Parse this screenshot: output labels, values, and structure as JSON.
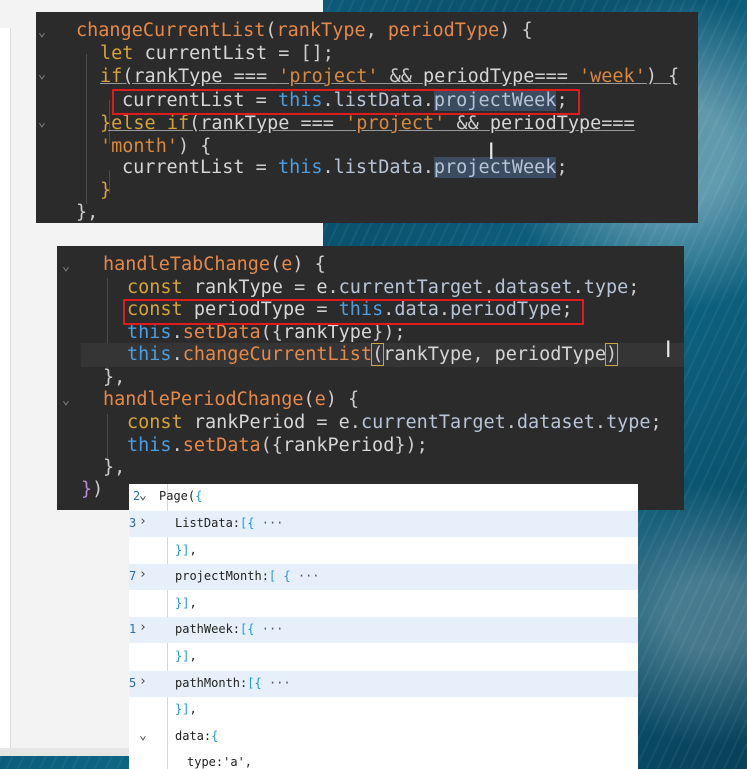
{
  "window1": {
    "lines": [
      {
        "t": "changeCurrentList(rankType, periodType) {"
      },
      {
        "t": "let currentList = [];"
      },
      {
        "t": "if(rankType === 'project' && periodType=== 'week') {"
      },
      {
        "t": "currentList = this.listData.projectWeek;"
      },
      {
        "t": "}else if(rankType === 'project' && periodType==="
      },
      {
        "t": "'month') {"
      },
      {
        "t": "currentList = this.listData.projectWeek;"
      },
      {
        "t": "}"
      },
      {
        "t": "},"
      }
    ]
  },
  "window2": {
    "lines": [
      {
        "t": "handleTabChange(e) {"
      },
      {
        "t": "const rankType = e.currentTarget.dataset.type;"
      },
      {
        "t": "const periodType = this.data.periodType;"
      },
      {
        "t": "this.setData({rankType});"
      },
      {
        "t": "this.changeCurrentList(rankType, periodType)"
      },
      {
        "t": "},"
      },
      {
        "t": "handlePeriodChange(e) {"
      },
      {
        "t": "const rankPeriod = e.currentTarget.dataset.type;"
      },
      {
        "t": "this.setData({rankPeriod});"
      },
      {
        "t": "},"
      },
      {
        "t": "})"
      }
    ]
  },
  "window3": {
    "rows": [
      {
        "label": "Page({",
        "num": "2"
      },
      {
        "label": "ListData:[{ ···",
        "num": "3"
      },
      {
        "label": "}],",
        "num": ""
      },
      {
        "label": "projectMonth:[ { ···",
        "num": "7"
      },
      {
        "label": "}],",
        "num": ""
      },
      {
        "label": "pathWeek:[{ ···",
        "num": "1"
      },
      {
        "label": "}],",
        "num": ""
      },
      {
        "label": "pathMonth:[{ ···",
        "num": "5"
      },
      {
        "label": "}],",
        "num": ""
      },
      {
        "label": "data:{",
        "num": ""
      },
      {
        "label": "type:'a',",
        "num": ""
      }
    ]
  }
}
